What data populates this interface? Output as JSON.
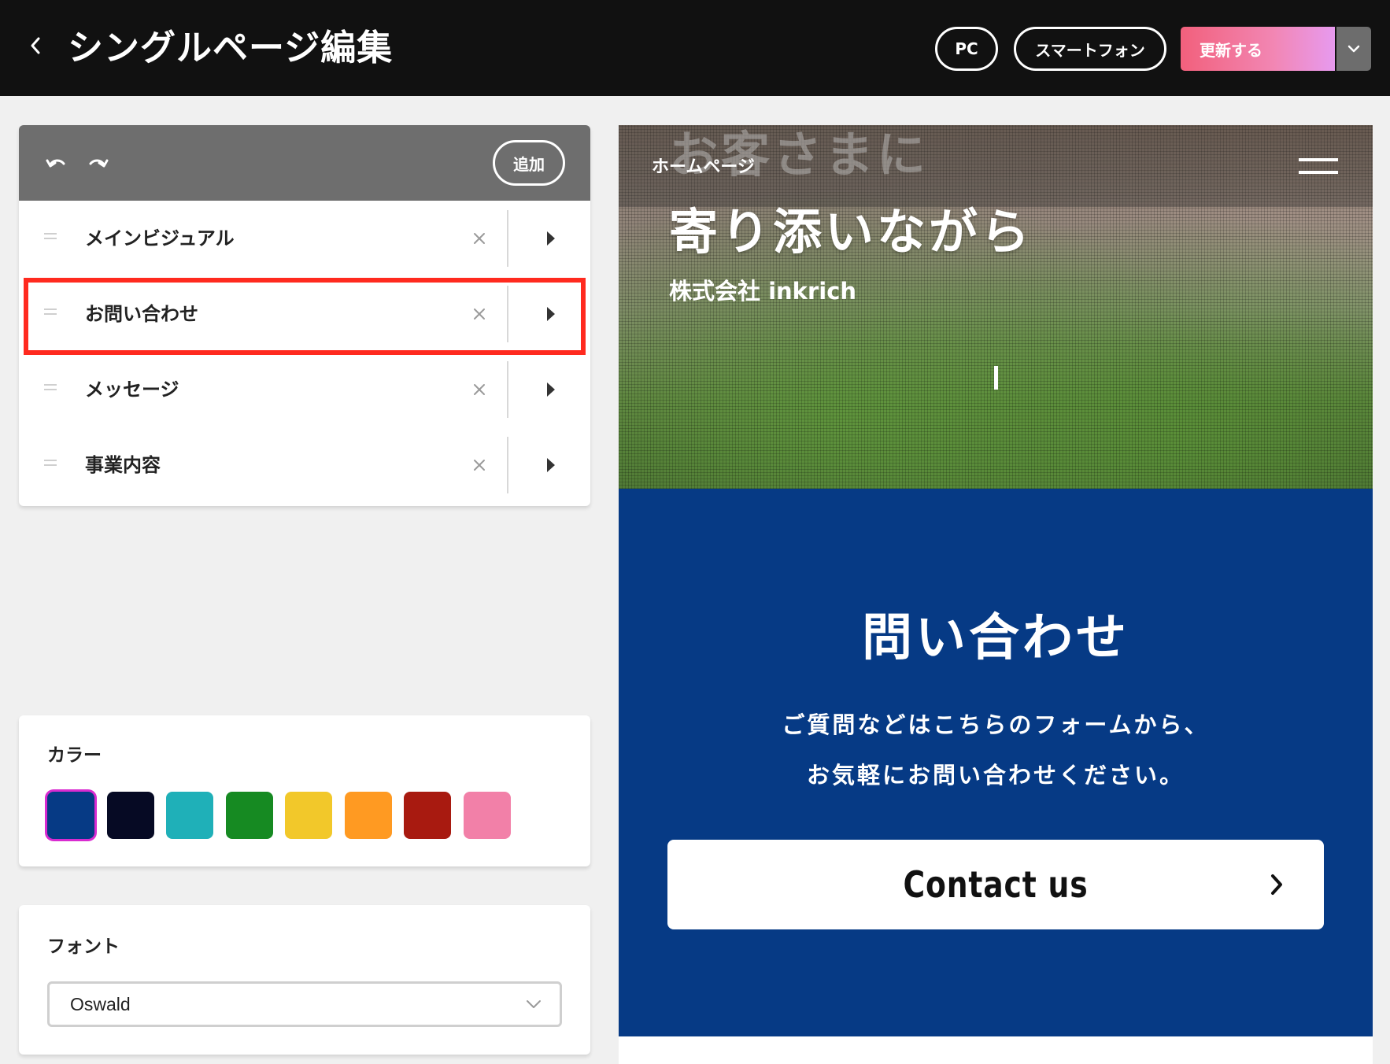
{
  "header": {
    "back_icon": "chevron-left-icon",
    "title": "シングルページ編集",
    "view_pc_label": "PC",
    "view_smartphone_label": "スマートフォン",
    "update_label": "更新する",
    "update_dropdown_icon": "chevron-down-icon",
    "accent_gradient": [
      "#f2607c",
      "#e79aef"
    ]
  },
  "sections_panel": {
    "undo_icon": "undo-icon",
    "redo_icon": "redo-icon",
    "add_label": "追加",
    "items": [
      {
        "label": "メインビジュアル",
        "selected": false
      },
      {
        "label": "お問い合わせ",
        "selected": true
      },
      {
        "label": "メッセージ",
        "selected": false
      },
      {
        "label": "事業内容",
        "selected": false
      }
    ]
  },
  "color_panel": {
    "heading": "カラー",
    "swatches": [
      "#063a85",
      "#060a24",
      "#1fb0b8",
      "#168a22",
      "#f2c82a",
      "#ff9a22",
      "#a81a10",
      "#f280a8"
    ],
    "selected_index": 0
  },
  "font_panel": {
    "heading": "フォント",
    "selected_font": "Oswald"
  },
  "preview": {
    "site_logo": "ホームページ",
    "hero_line1": "お客さまに",
    "hero_line2": "寄り添いながら",
    "hero_company": "株式会社 inkrich",
    "menu_icon": "hamburger-menu-icon",
    "contact": {
      "title": "問い合わせ",
      "description_line1": "ご質問などはこちらのフォームから、",
      "description_line2": "お気軽にお問い合わせください。",
      "button_label": "Contact us",
      "button_icon": "chevron-right-icon",
      "background_color": "#063a85"
    }
  }
}
